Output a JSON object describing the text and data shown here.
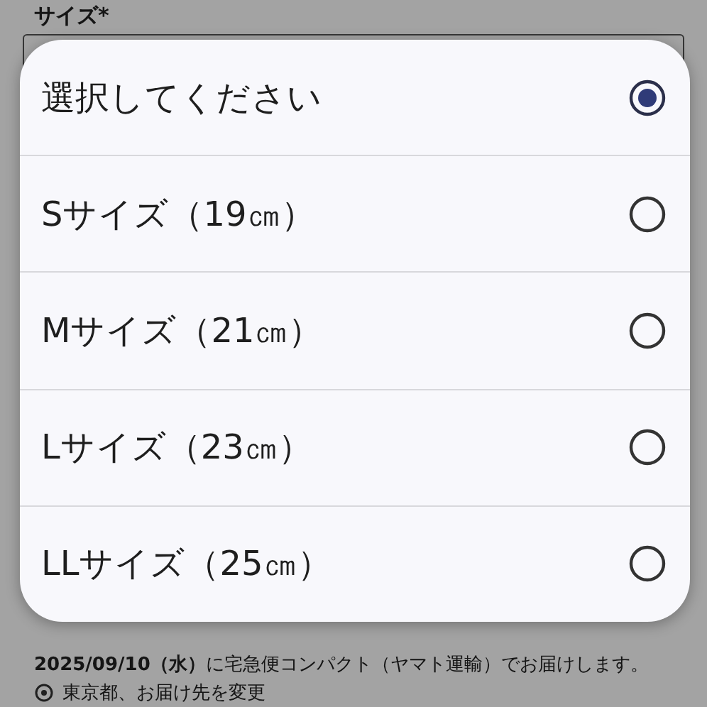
{
  "form": {
    "label": "サイズ*",
    "delivery_note": "**2025/09/10（水）**に宅急便コンパクト（ヤマト運輸）でお届けします。",
    "address_link": "東京都、お届け先を変更"
  },
  "dialog": {
    "options": [
      {
        "label": "選択してください",
        "selected": true
      },
      {
        "label": "Sサイズ（19㎝）",
        "selected": false
      },
      {
        "label": "Mサイズ（21㎝）",
        "selected": false
      },
      {
        "label": "Lサイズ（23㎝）",
        "selected": false
      },
      {
        "label": "LLサイズ（25㎝）",
        "selected": false
      }
    ]
  }
}
